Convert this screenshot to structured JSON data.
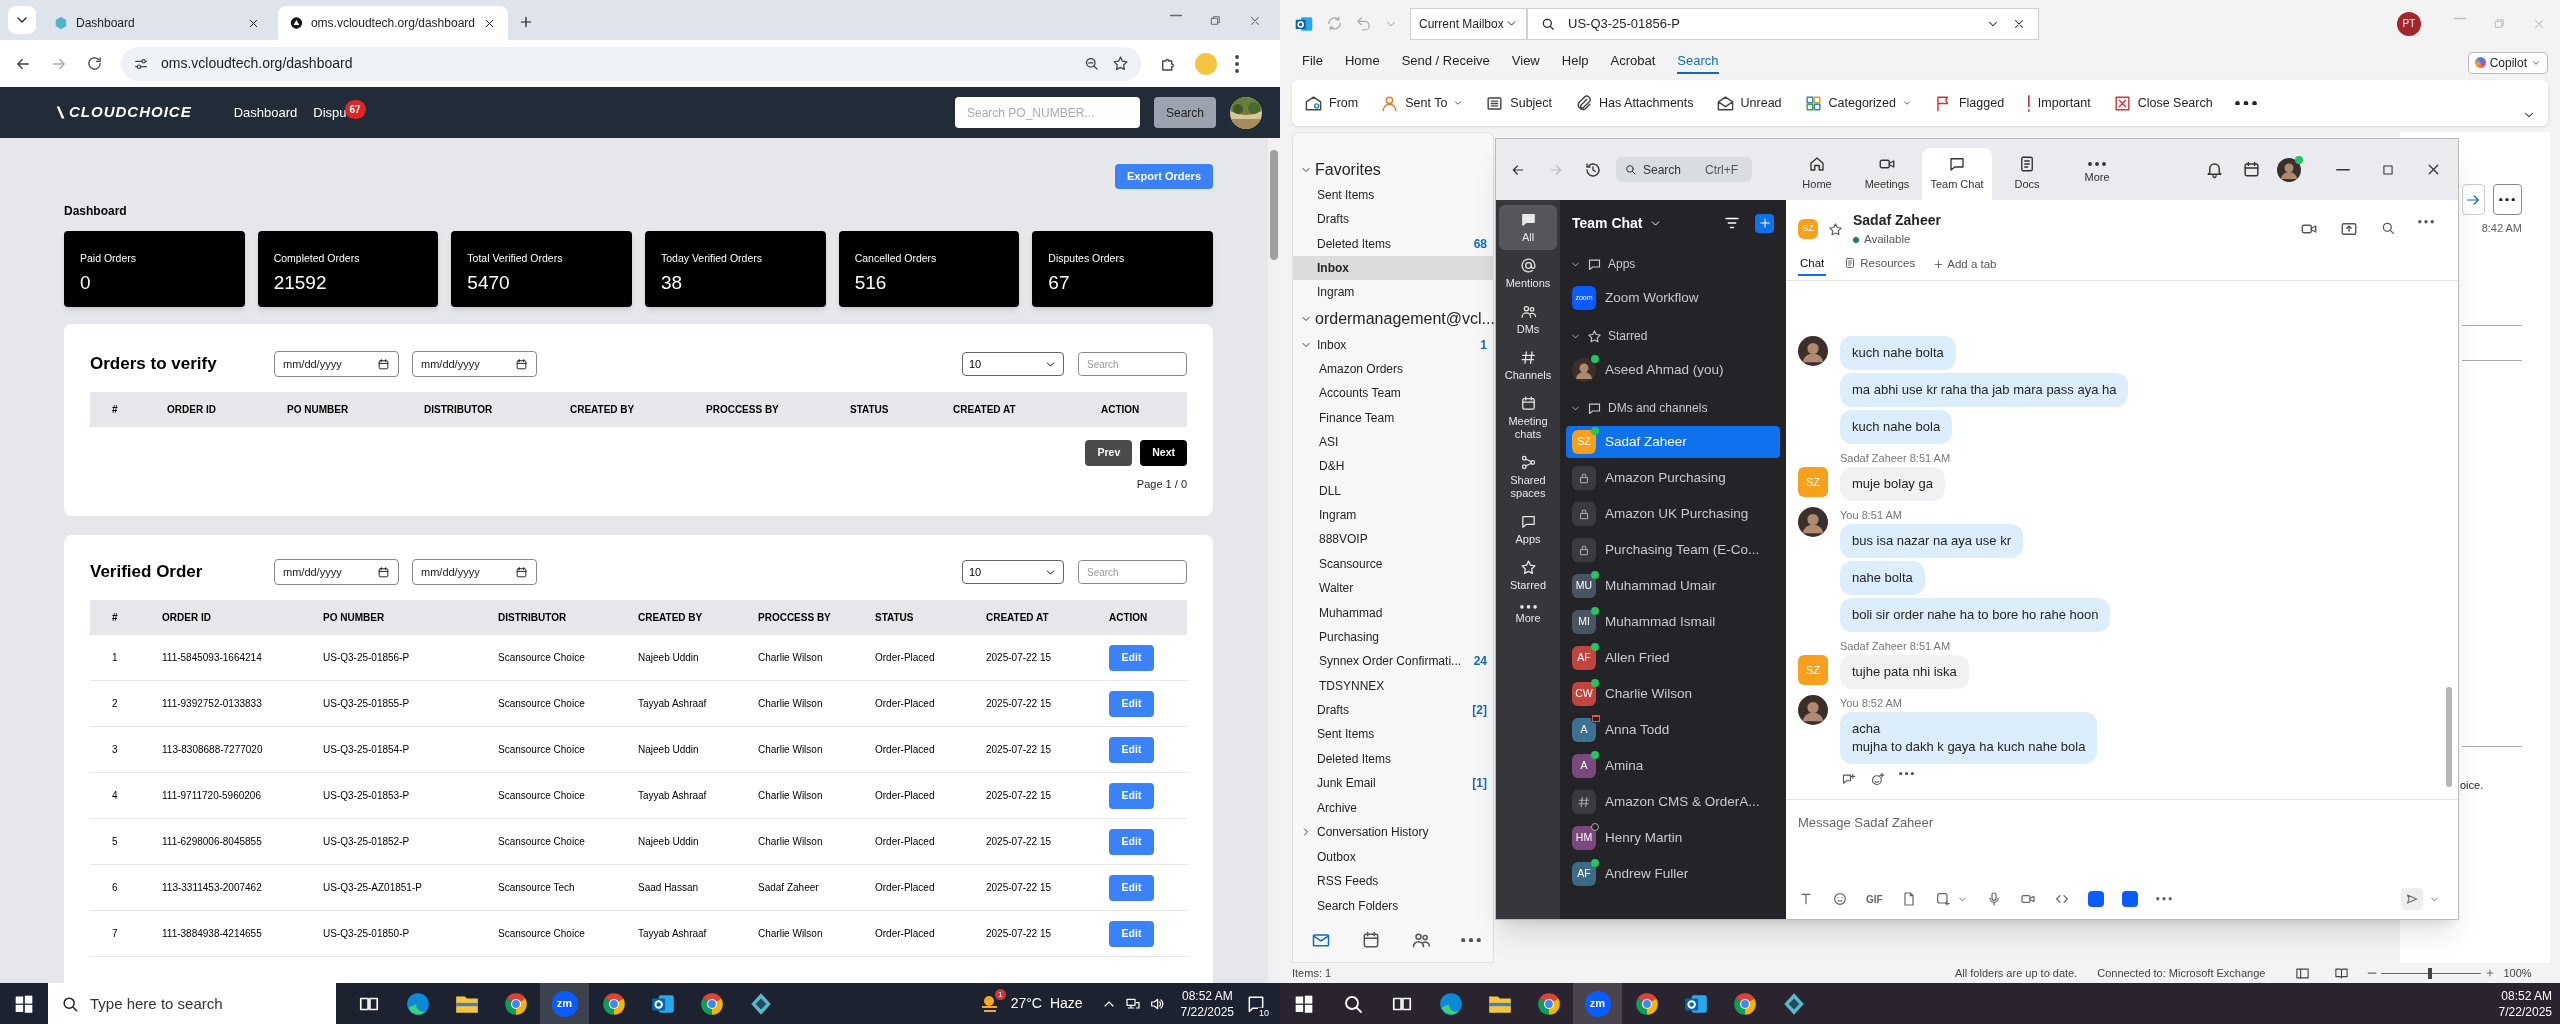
{
  "browser": {
    "tabs": [
      {
        "title": "Dashboard",
        "selected": false
      },
      {
        "title": "oms.vcloudtech.org/dashboard",
        "selected": true
      }
    ],
    "address": "oms.vcloudtech.org/dashboard"
  },
  "dashboard": {
    "logo": "CLOUDCHOICE",
    "nav": [
      {
        "label": "Dashboard"
      },
      {
        "label": "Dispu",
        "badge": "67"
      }
    ],
    "search": {
      "placeholder": "Search PO_NUMBER..."
    },
    "search_button": "Search",
    "export_button": "Export Orders",
    "title": "Dashboard",
    "stats": [
      {
        "label": "Paid Orders",
        "value": "0"
      },
      {
        "label": "Completed Orders",
        "value": "21592"
      },
      {
        "label": "Total Verified Orders",
        "value": "5470"
      },
      {
        "label": "Today Verified Orders",
        "value": "38"
      },
      {
        "label": "Cancelled Orders",
        "value": "516"
      },
      {
        "label": "Disputes Orders",
        "value": "67"
      }
    ],
    "orders_to_verify": {
      "title": "Orders to verify",
      "date_from": {
        "placeholder": "mm/dd/yyyy"
      },
      "date_to": {
        "placeholder": "mm/dd/yyyy"
      },
      "page_size": "10",
      "search": {
        "placeholder": "Search"
      },
      "columns": [
        "#",
        "ORDER ID",
        "PO NUMBER",
        "DISTRIBUTOR",
        "CREATED BY",
        "PROCCESS BY",
        "STATUS",
        "CREATED AT",
        "ACTION"
      ],
      "prev": "Prev",
      "next": "Next",
      "page_info": "Page 1 / 0"
    },
    "verified_order": {
      "title": "Verified Order",
      "date_from": {
        "placeholder": "mm/dd/yyyy"
      },
      "date_to": {
        "placeholder": "mm/dd/yyyy"
      },
      "page_size": "10",
      "search": {
        "placeholder": "Search"
      },
      "columns": [
        "#",
        "ORDER ID",
        "PO NUMBER",
        "DISTRIBUTOR",
        "CREATED BY",
        "PROCCESS BY",
        "STATUS",
        "CREATED AT",
        "ACTION"
      ],
      "rows": [
        {
          "cells": [
            "1",
            "111-5845093-1664214",
            "US-Q3-25-01856-P",
            "Scansource Choice",
            "Najeeb Uddin",
            "Charlie Wilson",
            "Order-Placed",
            "2025-07-22 15"
          ],
          "action": "Edit"
        },
        {
          "cells": [
            "2",
            "111-9392752-0133833",
            "US-Q3-25-01855-P",
            "Scansource Choice",
            "Tayyab Ashraaf",
            "Charlie Wilson",
            "Order-Placed",
            "2025-07-22 15"
          ],
          "action": "Edit"
        },
        {
          "cells": [
            "3",
            "113-8308688-7277020",
            "US-Q3-25-01854-P",
            "Scansource Choice",
            "Najeeb Uddin",
            "Charlie Wilson",
            "Order-Placed",
            "2025-07-22 15"
          ],
          "action": "Edit"
        },
        {
          "cells": [
            "4",
            "111-9711720-5960206",
            "US-Q3-25-01853-P",
            "Scansource Choice",
            "Tayyab Ashraaf",
            "Charlie Wilson",
            "Order-Placed",
            "2025-07-22 15"
          ],
          "action": "Edit"
        },
        {
          "cells": [
            "5",
            "111-6298006-8045855",
            "US-Q3-25-01852-P",
            "Scansource Choice",
            "Najeeb Uddin",
            "Charlie Wilson",
            "Order-Placed",
            "2025-07-22 15"
          ],
          "action": "Edit"
        },
        {
          "cells": [
            "6",
            "113-3311453-2007462",
            "US-Q3-25-AZ01851-P",
            "Scansource Tech",
            "Saad Hassan",
            "Sadaf Zaheer",
            "Order-Placed",
            "2025-07-22 15"
          ],
          "action": "Edit"
        },
        {
          "cells": [
            "7",
            "111-3884938-4214655",
            "US-Q3-25-01850-P",
            "Scansource Choice",
            "Tayyab Ashraaf",
            "Charlie Wilson",
            "Order-Placed",
            "2025-07-22 15"
          ],
          "action": "Edit"
        }
      ]
    }
  },
  "left_taskbar": {
    "search": {
      "placeholder": "Type here to search"
    },
    "apps": [
      {
        "kind": "taskview",
        "selected": false
      },
      {
        "kind": "edge",
        "selected": false
      },
      {
        "kind": "folder",
        "selected": false
      },
      {
        "kind": "chrome",
        "selected": false
      },
      {
        "kind": "zoom",
        "label": "zm",
        "selected": true
      },
      {
        "kind": "chrome",
        "selected": false
      },
      {
        "kind": "outlook",
        "selected": false
      },
      {
        "kind": "chrome",
        "selected": false
      },
      {
        "kind": "diamond",
        "selected": false
      }
    ],
    "weather_badge": "1",
    "temperature": "27°C",
    "weather": "Haze",
    "time": "08:52 AM",
    "date": "7/22/2025",
    "notifications": "10"
  },
  "outlook": {
    "scope": "Current Mailbox",
    "search": {
      "value": "US-Q3-25-01856-P"
    },
    "account_initials": "PT",
    "copilot": "Copilot",
    "menu": [
      {
        "label": "File",
        "selected": false
      },
      {
        "label": "Home",
        "selected": false
      },
      {
        "label": "Send / Receive",
        "selected": false
      },
      {
        "label": "View",
        "selected": false
      },
      {
        "label": "Help",
        "selected": false
      },
      {
        "label": "Acrobat",
        "selected": false
      },
      {
        "label": "Search",
        "selected": true
      }
    ],
    "ribbon": [
      {
        "label": "From",
        "kind": "from"
      },
      {
        "label": "Sent To",
        "kind": "sentto",
        "dropdown": true
      },
      {
        "label": "Subject",
        "kind": "subject"
      },
      {
        "label": "Has Attachments",
        "kind": "attach"
      },
      {
        "label": "Unread",
        "kind": "unread"
      },
      {
        "label": "Categorized",
        "kind": "categorized",
        "dropdown": true
      },
      {
        "label": "Flagged",
        "kind": "flagged"
      },
      {
        "label": "Important",
        "kind": "important"
      },
      {
        "label": "Close Search",
        "kind": "close"
      }
    ],
    "favorites": {
      "title": "Favorites",
      "expanded": true,
      "items": [
        {
          "name": "Sent Items",
          "selected": false
        },
        {
          "name": "Drafts",
          "selected": false
        },
        {
          "name": "Deleted Items",
          "count": "68",
          "selected": false
        },
        {
          "name": "Inbox",
          "selected": true
        },
        {
          "name": "Ingram",
          "selected": false
        }
      ]
    },
    "account": {
      "title": "ordermanagement@vcl...",
      "expanded": true,
      "folders": [
        {
          "name": "Inbox",
          "count": "1",
          "expanded": true,
          "selected": false,
          "children": [
            {
              "name": "Amazon Orders",
              "selected": false
            },
            {
              "name": "Accounts Team",
              "selected": false
            },
            {
              "name": "Finance Team",
              "selected": false
            },
            {
              "name": "ASI",
              "selected": false
            },
            {
              "name": "D&H",
              "selected": false
            },
            {
              "name": "DLL",
              "selected": false
            },
            {
              "name": "Ingram",
              "selected": false
            },
            {
              "name": "888VOIP",
              "selected": false
            },
            {
              "name": "Scansource",
              "selected": false
            },
            {
              "name": "Walter",
              "selected": false
            },
            {
              "name": "Muhammad",
              "selected": false
            },
            {
              "name": "Purchasing",
              "selected": false
            },
            {
              "name": "Synnex Order Confirmati...",
              "count": "24",
              "selected": false
            },
            {
              "name": "TDSYNNEX",
              "selected": false
            }
          ]
        },
        {
          "name": "Drafts",
          "count": "[2]",
          "selected": false
        },
        {
          "name": "Sent Items",
          "selected": false
        },
        {
          "name": "Deleted Items",
          "selected": false
        },
        {
          "name": "Junk Email",
          "count": "[1]",
          "selected": false
        },
        {
          "name": "Archive",
          "selected": false
        },
        {
          "name": "Conversation History",
          "expanded": false,
          "selected": false
        },
        {
          "name": "Outbox",
          "selected": false
        },
        {
          "name": "RSS Feeds",
          "selected": false
        },
        {
          "name": "Search Folders",
          "selected": false
        }
      ]
    },
    "reading_time": "8:42 AM",
    "reading_text": "oice.",
    "status": {
      "items": "Items: 1",
      "sync": "All folders are up to date.",
      "connection": "Connected to: Microsoft Exchange",
      "zoom": "100%",
      "slider": {
        "level": 0.48
      }
    }
  },
  "zoom": {
    "search": {
      "placeholder": "Search",
      "shortcut": "Ctrl+F"
    },
    "nav": [
      {
        "label": "Home",
        "kind": "home",
        "selected": false
      },
      {
        "label": "Meetings",
        "kind": "video",
        "selected": false
      },
      {
        "label": "Team Chat",
        "kind": "chat",
        "selected": true
      },
      {
        "label": "Docs",
        "kind": "doc",
        "selected": false
      },
      {
        "label": "More",
        "kind": "dotsh",
        "selected": false
      }
    ],
    "rail": [
      {
        "label": "All",
        "kind": "all",
        "selected": true
      },
      {
        "label": "Mentions",
        "kind": "at",
        "selected": false
      },
      {
        "label": "DMs",
        "kind": "people",
        "selected": false
      },
      {
        "label": "Channels",
        "kind": "hash",
        "selected": false
      },
      {
        "label": "Meeting chats",
        "kind": "cal",
        "selected": false
      },
      {
        "label": "Shared spaces",
        "kind": "share",
        "selected": false
      },
      {
        "label": "Apps",
        "kind": "chat",
        "selected": false
      },
      {
        "label": "Starred",
        "kind": "star",
        "selected": false
      },
      {
        "label": "More",
        "kind": "dotsh",
        "selected": false
      }
    ],
    "list_title": "Team Chat",
    "sections": [
      {
        "title": "Apps",
        "kind": "apps",
        "expanded": true,
        "items": [
          {
            "name": "Zoom Workflow",
            "kind": "app",
            "logo": "zoom",
            "selected": false
          }
        ]
      },
      {
        "title": "Starred",
        "kind": "starred",
        "expanded": true,
        "items": [
          {
            "name": "Aseed Ahmad (you)",
            "kind": "self",
            "online": true,
            "selected": false
          }
        ]
      },
      {
        "title": "DMs and channels",
        "kind": "dms",
        "expanded": true,
        "items": [
          {
            "name": "Sadaf Zaheer",
            "kind": "person",
            "initials": "SZ",
            "color": "#f7a01d",
            "online": true,
            "selected": true
          },
          {
            "name": "Amazon Purchasing",
            "kind": "private",
            "selected": false
          },
          {
            "name": "Amazon UK Purchasing",
            "kind": "private",
            "selected": false
          },
          {
            "name": "Purchasing Team (E-Co...",
            "kind": "private",
            "selected": false
          },
          {
            "name": "Muhammad Umair",
            "kind": "person",
            "initials": "MU",
            "color": "#4a5563",
            "online": true,
            "selected": false
          },
          {
            "name": "Muhammad Ismail",
            "kind": "person",
            "initials": "MI",
            "color": "#4a5563",
            "online": true,
            "selected": false
          },
          {
            "name": "Allen Fried",
            "kind": "person",
            "initials": "AF",
            "color": "#c0453c",
            "online": true,
            "selected": false
          },
          {
            "name": "Charlie Wilson",
            "kind": "person",
            "initials": "CW",
            "color": "#c0453c",
            "online": true,
            "selected": false
          },
          {
            "name": "Anna Todd",
            "kind": "person",
            "initials": "A",
            "color": "#3d7294",
            "meeting": true,
            "selected": false
          },
          {
            "name": "Amina",
            "kind": "person",
            "initials": "A",
            "color": "#7a4a7e",
            "online": true,
            "selected": false
          },
          {
            "name": "Amazon CMS & OrderA...",
            "kind": "channel",
            "selected": false
          },
          {
            "name": "Henry Martin",
            "kind": "person",
            "initials": "HM",
            "color": "#7a4a7e",
            "online": false,
            "selected": false
          },
          {
            "name": "Andrew Fuller",
            "kind": "person",
            "initials": "AF",
            "color": "#3d6a85",
            "online": true,
            "selected": false
          }
        ]
      }
    ],
    "chat": {
      "name": "Sadaf Zaheer",
      "initials": "SZ",
      "status": "Available",
      "tabs": [
        {
          "label": "Chat",
          "selected": true
        },
        {
          "label": "Resources",
          "selected": false
        }
      ],
      "add_tab": "Add a tab",
      "groups": [
        {
          "kind": "self",
          "messages": [
            "kuch nahe bolta",
            "ma abhi use kr raha tha jab mara pass aya ha",
            "kuch nahe bola"
          ]
        },
        {
          "kind": "other",
          "author": "Sadaf Zaheer",
          "time": "8:51 AM",
          "initials": "SZ",
          "messages": [
            "muje bolay ga"
          ]
        },
        {
          "kind": "self",
          "author": "You",
          "time": "8:51 AM",
          "messages": [
            "bus isa nazar na aya use kr",
            "nahe bolta",
            "boli sir order nahe ha to bore ho rahe hoon"
          ]
        },
        {
          "kind": "other",
          "author": "Sadaf Zaheer",
          "time": "8:51 AM",
          "initials": "SZ",
          "messages": [
            "tujhe pata nhi iska"
          ]
        },
        {
          "kind": "self",
          "author": "You",
          "time": "8:52 AM",
          "messages": [
            "acha\nmujha to dakh k gaya ha kuch nahe bola"
          ]
        }
      ],
      "input": {
        "placeholder": "Message Sadaf Zaheer"
      },
      "gif_label": "GIF"
    }
  },
  "right_taskbar": {
    "apps": [
      {
        "kind": "search",
        "selected": false
      },
      {
        "kind": "taskview",
        "selected": false
      },
      {
        "kind": "edge",
        "selected": false
      },
      {
        "kind": "folder",
        "selected": false
      },
      {
        "kind": "chrome",
        "selected": false
      },
      {
        "kind": "zoom",
        "label": "zm",
        "selected": true
      },
      {
        "kind": "chrome",
        "selected": false
      },
      {
        "kind": "outlook",
        "selected": false
      },
      {
        "kind": "chrome",
        "selected": false
      },
      {
        "kind": "diamond",
        "selected": false
      }
    ],
    "time": "08:52 AM",
    "date": "7/22/2025"
  }
}
